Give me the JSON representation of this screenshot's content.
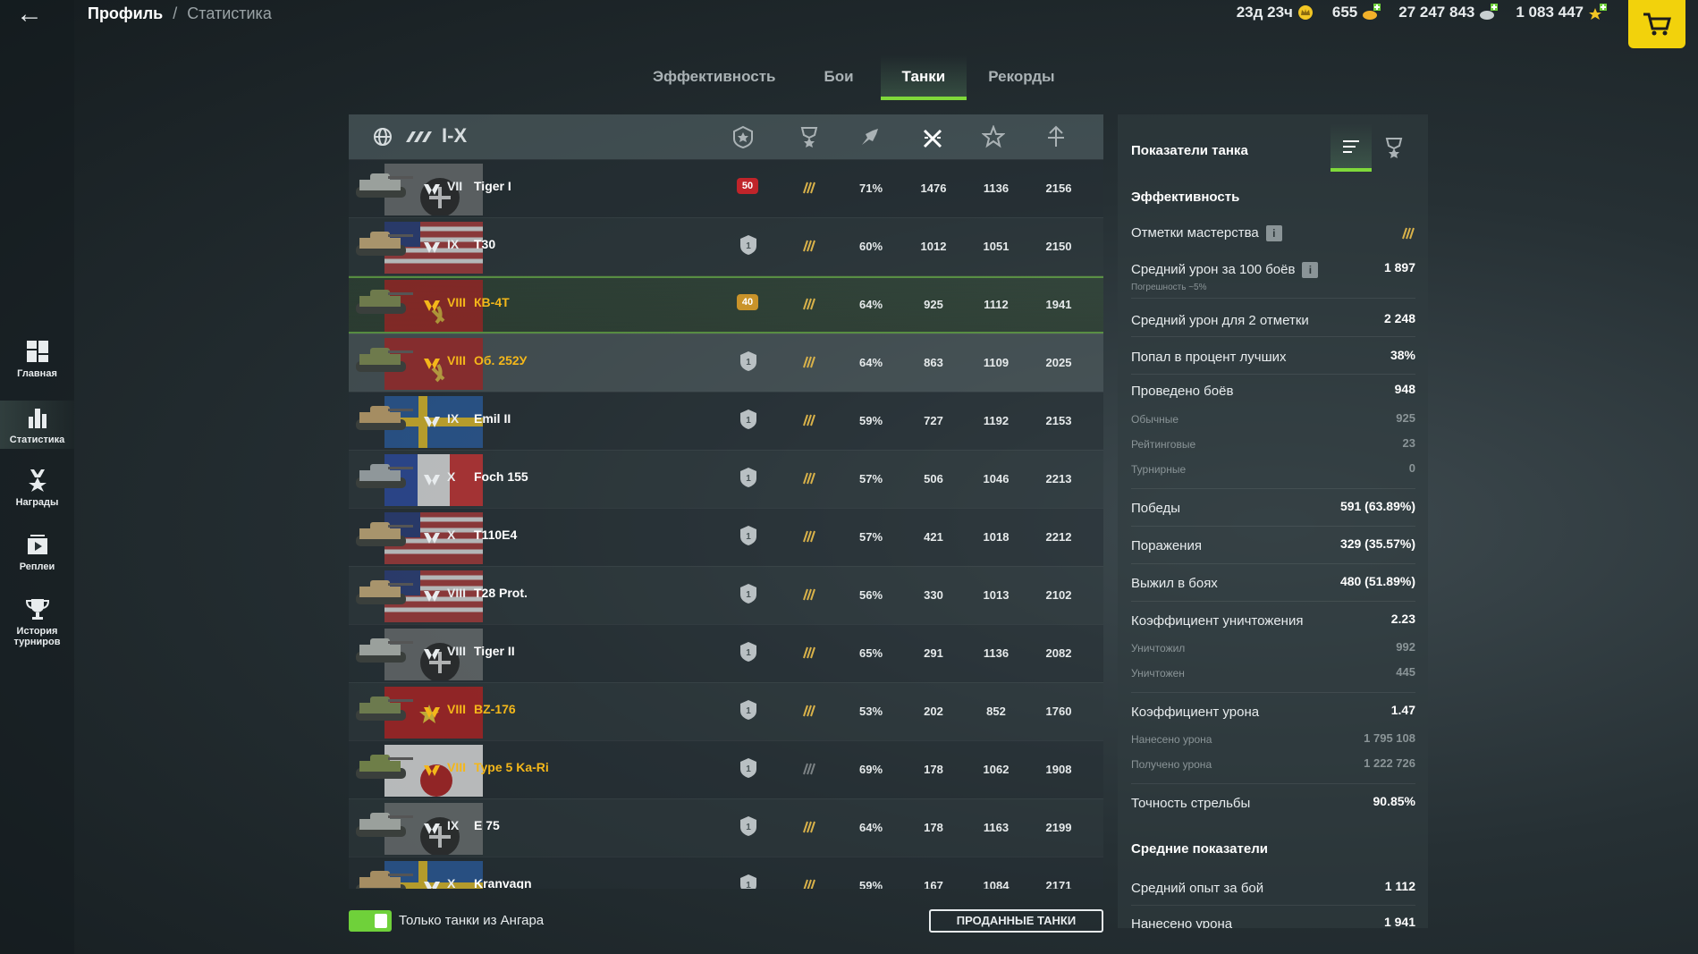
{
  "breadcrumb": {
    "profile": "Профиль",
    "separator": "/",
    "current": "Статистика"
  },
  "currencies": [
    {
      "value": "23д 23ч",
      "color": "#f2c624",
      "icon": "premium-crown-icon"
    },
    {
      "value": "655",
      "color": "#f2b12a",
      "icon": "gold-icon"
    },
    {
      "value": "27 247 843",
      "color": "#c9cfd1",
      "icon": "credits-icon"
    },
    {
      "value": "1 083 447",
      "color": "#f2c624",
      "icon": "free-xp-star-icon"
    }
  ],
  "sidebar": {
    "items": [
      {
        "label": "Главная",
        "icon": "home-grid-icon"
      },
      {
        "label": "Статистика",
        "icon": "bar-chart-icon"
      },
      {
        "label": "Награды",
        "icon": "medal-icon"
      },
      {
        "label": "Реплеи",
        "icon": "replay-icon"
      },
      {
        "label": "История турниров",
        "icon": "trophy-icon"
      }
    ]
  },
  "tabs": [
    {
      "label": "Эффективность"
    },
    {
      "label": "Бои"
    },
    {
      "label": "Танки"
    },
    {
      "label": "Рекорды"
    }
  ],
  "filters": {
    "tier_range": "I-X"
  },
  "tanks": [
    {
      "tier": "VII",
      "name": "Tiger I",
      "nation": "germany",
      "premium": false,
      "mastery": "50",
      "mastery_color": "#c0242a",
      "win": "71%",
      "battles": "1476",
      "xp": "1136",
      "dmg": "2156"
    },
    {
      "tier": "IX",
      "name": "T30",
      "nation": "usa",
      "premium": false,
      "mastery": "1",
      "mastery_color": "",
      "win": "60%",
      "battles": "1012",
      "xp": "1051",
      "dmg": "2150"
    },
    {
      "tier": "VIII",
      "name": "КВ-4Т",
      "nation": "ussr",
      "premium": true,
      "mastery": "40",
      "mastery_color": "#c9932a",
      "win": "64%",
      "battles": "925",
      "xp": "1112",
      "dmg": "1941"
    },
    {
      "tier": "VIII",
      "name": "Об. 252У",
      "nation": "ussr",
      "premium": true,
      "mastery": "1",
      "mastery_color": "",
      "win": "64%",
      "battles": "863",
      "xp": "1109",
      "dmg": "2025"
    },
    {
      "tier": "IX",
      "name": "Emil II",
      "nation": "sweden",
      "premium": false,
      "mastery": "1",
      "mastery_color": "",
      "win": "59%",
      "battles": "727",
      "xp": "1192",
      "dmg": "2153"
    },
    {
      "tier": "X",
      "name": "Foch 155",
      "nation": "france",
      "premium": false,
      "mastery": "1",
      "mastery_color": "",
      "win": "57%",
      "battles": "506",
      "xp": "1046",
      "dmg": "2213"
    },
    {
      "tier": "X",
      "name": "T110E4",
      "nation": "usa",
      "premium": false,
      "mastery": "1",
      "mastery_color": "",
      "win": "57%",
      "battles": "421",
      "xp": "1018",
      "dmg": "2212"
    },
    {
      "tier": "VIII",
      "name": "T28 Prot.",
      "nation": "usa",
      "premium": false,
      "mastery": "1",
      "mastery_color": "",
      "win": "56%",
      "battles": "330",
      "xp": "1013",
      "dmg": "2102"
    },
    {
      "tier": "VIII",
      "name": "Tiger II",
      "nation": "germany",
      "premium": false,
      "mastery": "1",
      "mastery_color": "",
      "win": "65%",
      "battles": "291",
      "xp": "1136",
      "dmg": "2082"
    },
    {
      "tier": "VIII",
      "name": "BZ-176",
      "nation": "china",
      "premium": true,
      "mastery": "1",
      "mastery_color": "",
      "win": "53%",
      "battles": "202",
      "xp": "852",
      "dmg": "1760"
    },
    {
      "tier": "VIII",
      "name": "Type 5 Ka-Ri",
      "nation": "japan",
      "premium": true,
      "mastery": "1",
      "mastery_color": "",
      "win": "69%",
      "battles": "178",
      "xp": "1062",
      "dmg": "1908"
    },
    {
      "tier": "IX",
      "name": "E 75",
      "nation": "germany",
      "premium": false,
      "mastery": "1",
      "mastery_color": "",
      "win": "64%",
      "battles": "178",
      "xp": "1163",
      "dmg": "2199"
    },
    {
      "tier": "X",
      "name": "Kranvagn",
      "nation": "sweden",
      "premium": false,
      "mastery": "1",
      "mastery_color": "",
      "win": "59%",
      "battles": "167",
      "xp": "1084",
      "dmg": "2171"
    }
  ],
  "footer": {
    "hangar_only": "Только танки из Ангара",
    "sold_tanks": "ПРОДАННЫЕ ТАНКИ"
  },
  "panel": {
    "title": "Показатели танка",
    "sections": [
      {
        "title": "Эффективность"
      },
      {
        "title": "Средние показатели"
      }
    ],
    "rows": {
      "marks": {
        "label": "Отметки мастерства"
      },
      "avg_dmg_100": {
        "label": "Средний урон за 100 боёв",
        "value": "1 897",
        "note": "Погрешность ~5%"
      },
      "avg_dmg_2marks": {
        "label": "Средний урон для 2 отметки",
        "value": "2 248"
      },
      "top_percent": {
        "label": "Попал в процент лучших",
        "value": "38%"
      },
      "battles": {
        "label": "Проведено боёв",
        "value": "948"
      },
      "regular": {
        "label": "Обычные",
        "value": "925"
      },
      "rated": {
        "label": "Рейтинговые",
        "value": "23"
      },
      "tournament": {
        "label": "Турнирные",
        "value": "0"
      },
      "wins": {
        "label": "Победы",
        "value": "591 (63.89%)"
      },
      "losses": {
        "label": "Поражения",
        "value": "329 (35.57%)"
      },
      "survived": {
        "label": "Выжил в боях",
        "value": "480 (51.89%)"
      },
      "kill_ratio": {
        "label": "Коэффициент уничтожения",
        "value": "2.23"
      },
      "destroyed": {
        "label": "Уничтожил",
        "value": "992"
      },
      "was_destroyed": {
        "label": "Уничтожен",
        "value": "445"
      },
      "dmg_ratio": {
        "label": "Коэффициент урона",
        "value": "1.47"
      },
      "dmg_dealt": {
        "label": "Нанесено урона",
        "value": "1 795 108"
      },
      "dmg_received": {
        "label": "Получено урона",
        "value": "1 222 726"
      },
      "accuracy": {
        "label": "Точность стрельбы",
        "value": "90.85%"
      },
      "avg_xp": {
        "label": "Средний опыт за бой",
        "value": "1 112"
      },
      "avg_dmg": {
        "label": "Нанесено урона",
        "value": "1 941"
      }
    }
  }
}
